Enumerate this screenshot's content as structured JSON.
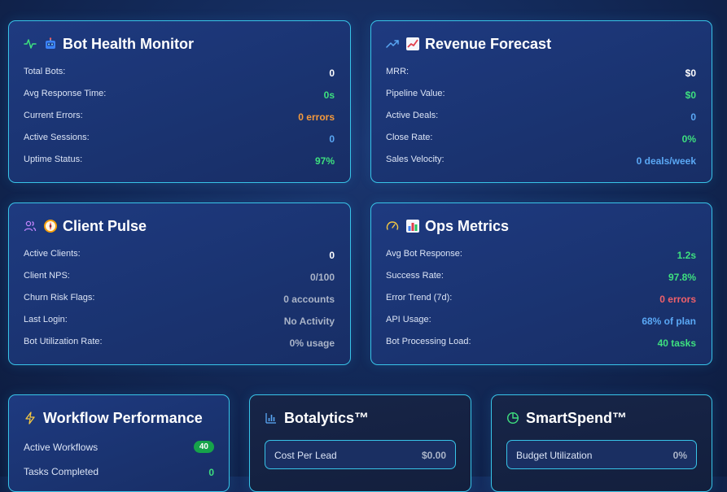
{
  "bot_health": {
    "title": "Bot Health Monitor",
    "icon": "activity-icon",
    "emoji": "🤖",
    "rows": [
      {
        "label": "Total Bots:",
        "value": "0"
      },
      {
        "label": "Avg Response Time:",
        "value": "0s"
      },
      {
        "label": "Current Errors:",
        "value": "0 errors"
      },
      {
        "label": "Active Sessions:",
        "value": "0"
      },
      {
        "label": "Uptime Status:",
        "value": "97%"
      }
    ]
  },
  "revenue": {
    "title": "Revenue Forecast",
    "icon": "trending-up-icon",
    "emoji": "📈",
    "rows": [
      {
        "label": "MRR:",
        "value": "$0"
      },
      {
        "label": "Pipeline Value:",
        "value": "$0"
      },
      {
        "label": "Active Deals:",
        "value": "0"
      },
      {
        "label": "Close Rate:",
        "value": "0%"
      },
      {
        "label": "Sales Velocity:",
        "value": "0 deals/week"
      }
    ]
  },
  "client_pulse": {
    "title": "Client Pulse",
    "icon": "users-icon",
    "emoji": "🧭",
    "rows": [
      {
        "label": "Active Clients:",
        "value": "0"
      },
      {
        "label": "Client NPS:",
        "value": "0/100"
      },
      {
        "label": "Churn Risk Flags:",
        "value": "0 accounts"
      },
      {
        "label": "Last Login:",
        "value": "No Activity"
      },
      {
        "label": "Bot Utilization Rate:",
        "value": "0% usage"
      }
    ]
  },
  "ops": {
    "title": "Ops Metrics",
    "icon": "gauge-icon",
    "emoji": "📊",
    "rows": [
      {
        "label": "Avg Bot Response:",
        "value": "1.2s"
      },
      {
        "label": "Success Rate:",
        "value": "97.8%"
      },
      {
        "label": "Error Trend (7d):",
        "value": "0 errors"
      },
      {
        "label": "API Usage:",
        "value": "68% of plan"
      },
      {
        "label": "Bot Processing Load:",
        "value": "40 tasks"
      }
    ]
  },
  "workflow": {
    "title": "Workflow Performance",
    "icon": "zap-icon",
    "rows": [
      {
        "label": "Active Workflows",
        "value": "40"
      },
      {
        "label": "Tasks Completed",
        "value": "0"
      }
    ]
  },
  "botalytics": {
    "title": "Botalytics™",
    "icon": "bar-chart-icon",
    "item": {
      "label": "Cost Per Lead",
      "value": "$0.00"
    }
  },
  "smartspend": {
    "title": "SmartSpend™",
    "icon": "pie-chart-icon",
    "item": {
      "label": "Budget Utilization",
      "value": "0%"
    }
  },
  "colors": {
    "border": "#38c4e8",
    "green": "#3ee07f",
    "orange": "#f59a3c",
    "blue": "#5aa8f5",
    "gray": "#aab4c8",
    "red": "#f0606a"
  }
}
